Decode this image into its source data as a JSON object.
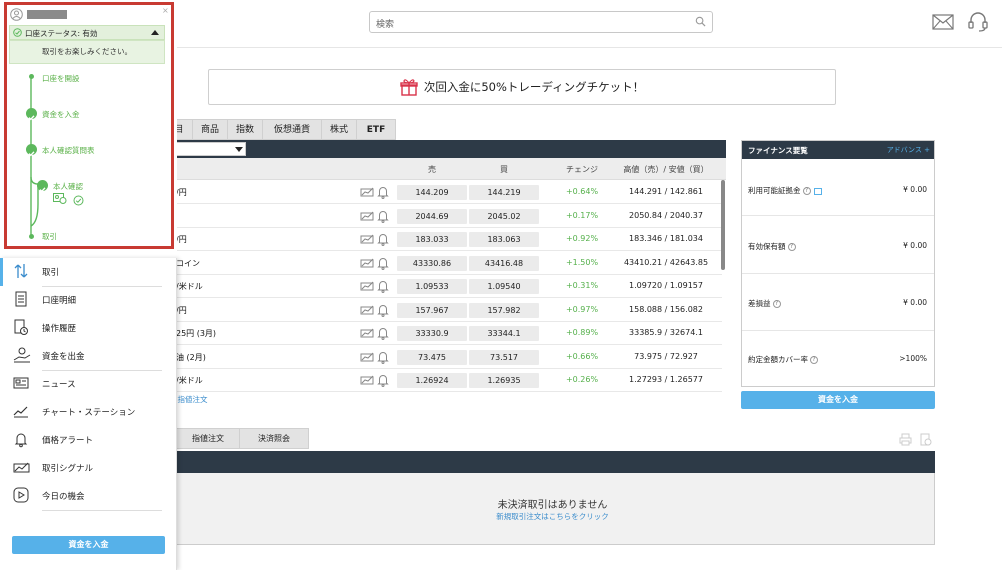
{
  "header": {
    "search_placeholder": "検索",
    "icons": [
      "search-icon",
      "mail-icon",
      "headset-icon"
    ]
  },
  "promo": {
    "text": "次回入金に50%トレーディングチケット！",
    "icon": "gift-icon"
  },
  "tabs": {
    "items": [
      "商品",
      "指数",
      "仮想通貨",
      "株式",
      "ETF"
    ],
    "partial": "目"
  },
  "table": {
    "columns": {
      "sell": "売",
      "buy": "買",
      "change": "チェンジ",
      "highlow": "高値（売）/ 安値（買）"
    },
    "rows": [
      {
        "name": "/円",
        "sell": "144.209",
        "buy": "144.219",
        "change": "+0.64%",
        "highlow": "144.291 / 142.861"
      },
      {
        "name": "",
        "sell": "2044.69",
        "buy": "2045.02",
        "change": "+0.17%",
        "highlow": "2050.84 / 2040.37"
      },
      {
        "name": "/円",
        "sell": "183.033",
        "buy": "183.063",
        "change": "+0.92%",
        "highlow": "183.346 / 181.034"
      },
      {
        "name": "コイン",
        "sell": "43330.86",
        "buy": "43416.48",
        "change": "+1.50%",
        "highlow": "43410.21 / 42643.85"
      },
      {
        "name": "/米ドル",
        "sell": "1.09533",
        "buy": "1.09540",
        "change": "+0.31%",
        "highlow": "1.09720 / 1.09157"
      },
      {
        "name": "/円",
        "sell": "157.967",
        "buy": "157.982",
        "change": "+0.97%",
        "highlow": "158.088 / 156.082"
      },
      {
        "name": "25円 (3月)",
        "sell": "33330.9",
        "buy": "33344.1",
        "change": "+0.89%",
        "highlow": "33385.9 / 32674.1"
      },
      {
        "name": "油 (2月)",
        "sell": "73.475",
        "buy": "73.517",
        "change": "+0.66%",
        "highlow": "73.975 / 72.927"
      },
      {
        "name": "/米ドル",
        "sell": "1.26924",
        "buy": "1.26935",
        "change": "+0.26%",
        "highlow": "1.27293 / 1.26577"
      }
    ],
    "limit_link": "限指値注文"
  },
  "finance": {
    "title": "ファイナンス要覧",
    "advanced": "アドバンス +",
    "rows": [
      {
        "label": "利用可能証拠金",
        "value": "¥ 0.00"
      },
      {
        "label": "有効保有額",
        "value": "¥ 0.00"
      },
      {
        "label": "差損益",
        "value": "¥ 0.00"
      },
      {
        "label": "約定金額カバー率",
        "value": ">100%"
      }
    ],
    "deposit_button": "資金を入金"
  },
  "bottom": {
    "tabs": [
      "指値注文",
      "決済照会"
    ],
    "empty_title": "未決済取引はありません",
    "empty_link": "新規取引注文はこちらをクリック"
  },
  "overlay": {
    "account_status": "口座ステータス: 有効",
    "status_message": "取引をお楽しみください。",
    "steps": [
      "口座を開設",
      "資金を入金",
      "本人確認質問表",
      "本人確認",
      "取引"
    ]
  },
  "sidemenu": {
    "items": [
      {
        "label": "取引",
        "icon": "trade-arrows-icon"
      },
      {
        "label": "口座明細",
        "icon": "statement-icon"
      },
      {
        "label": "操作履歴",
        "icon": "history-icon"
      },
      {
        "label": "資金を出金",
        "icon": "withdraw-icon"
      },
      {
        "label": "ニュース",
        "icon": "news-icon"
      },
      {
        "label": "チャート・ステーション",
        "icon": "chart-icon"
      },
      {
        "label": "価格アラート",
        "icon": "bell-icon"
      },
      {
        "label": "取引シグナル",
        "icon": "signal-icon"
      },
      {
        "label": "今日の機会",
        "icon": "play-icon"
      }
    ],
    "deposit_button": "資金を入金"
  },
  "colors": {
    "dark_bar": "#2d3a47",
    "green": "#5cb85c",
    "blue_button": "#56b1e9",
    "red_highlight": "#c83a32"
  }
}
